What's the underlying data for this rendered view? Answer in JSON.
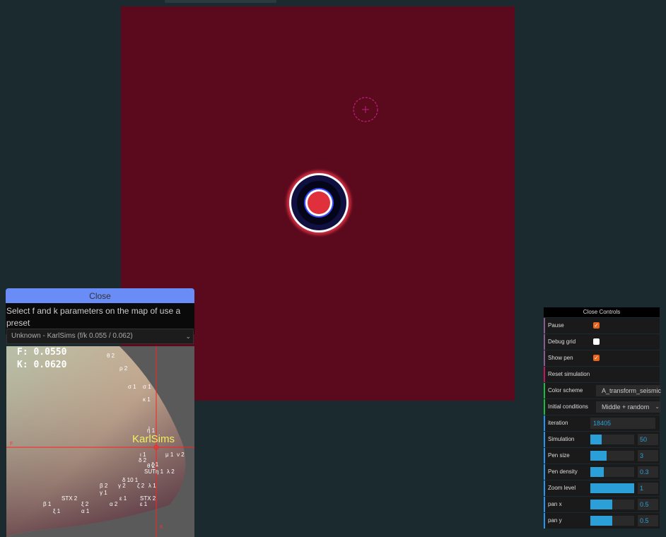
{
  "preset_panel": {
    "close_label": "Close",
    "instruction": "Select f and k parameters on the map of use a preset",
    "selected_preset": "Unknown - KarlSims (f/k 0.055 / 0.062)",
    "f_readout": "F: 0.0550",
    "k_readout": "K: 0.0620",
    "crosshair_label": "KarlSims",
    "axis_f_label": "F",
    "axis_k_label": "K",
    "map_labels": [
      "θ 2",
      "ρ 2",
      "σ 1",
      "σ 1",
      "κ 1",
      "ι",
      "η 1",
      "μ 1",
      "ν 2",
      "ι 1",
      "δ 2",
      "θ 2",
      "ζ 1",
      "SUT",
      "η 1",
      "λ 2",
      "δ 10 1",
      "β 2",
      "γ 2",
      "ζ 2",
      "λ 1",
      "γ 1",
      "STX 2",
      "ε 1",
      "STX 2",
      "β 1",
      "ξ 2",
      "α 2",
      "ε 1",
      "ξ 1",
      "α 1"
    ]
  },
  "controls": {
    "close_label": "Close Controls",
    "pause": {
      "label": "Pause",
      "checked": true
    },
    "debug_grid": {
      "label": "Debug grid",
      "checked": false
    },
    "show_pen": {
      "label": "Show pen",
      "checked": true
    },
    "reset_label": "Reset simulation",
    "color_scheme": {
      "label": "Color scheme",
      "value": "A_transform_seismic"
    },
    "initial_conditions": {
      "label": "Initial conditions",
      "value": "Middle + random"
    },
    "iteration": {
      "label": "iteration",
      "value": "18405"
    },
    "sliders": [
      {
        "label": "Simulation",
        "value": "50",
        "level": 0.25
      },
      {
        "label": "Pen size",
        "value": "3",
        "level": 0.37
      },
      {
        "label": "Pen density",
        "value": "0.3",
        "level": 0.3
      },
      {
        "label": "Zoom level",
        "value": "1",
        "level": 1.0
      },
      {
        "label": "pan x",
        "value": "0.5",
        "level": 0.5
      },
      {
        "label": "pan y",
        "value": "0.5",
        "level": 0.5
      }
    ]
  },
  "colors": {
    "canvas_bg": "#5a0a1c",
    "accent": "#2a9fd8",
    "checkbox": "#e8641c",
    "close_button": "#6a8cf7"
  }
}
